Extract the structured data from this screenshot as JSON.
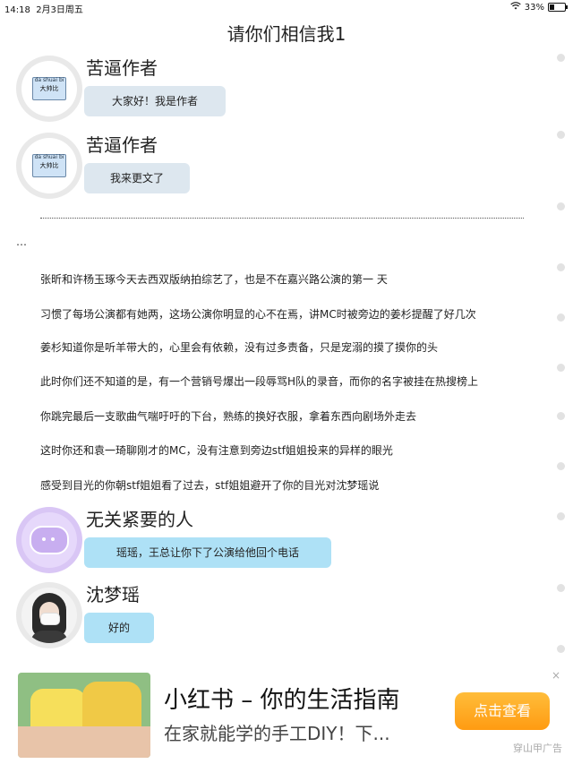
{
  "status_bar": {
    "time": "14:18",
    "date": "2月3日周五",
    "battery": "33%",
    "battery_level": 0.33
  },
  "page": {
    "title": "请你们相信我1"
  },
  "messages": [
    {
      "name": "苦逼作者",
      "text": "大家好！我是作者",
      "avatar_label_small": "da shuai bi",
      "avatar_label_big": "大帅比"
    },
    {
      "name": "苦逼作者",
      "text": "我来更文了",
      "avatar_label_small": "da shuai bi",
      "avatar_label_big": "大帅比"
    },
    {
      "name": "无关紧要的人",
      "text": "瑶瑶，王总让你下了公演给他回个电话"
    },
    {
      "name": "沈梦瑶",
      "text": "好的"
    }
  ],
  "narration": {
    "dots": "……………………………………………………………………………………………………………………………",
    "ellipsis": "…",
    "paragraphs": [
      "张昕和许杨玉琢今天去西双版纳拍综艺了，也是不在嘉兴路公演的第一 天",
      "习惯了每场公演都有她两，这场公演你明显的心不在焉，讲MC时被旁边的姜杉提醒了好几次",
      "姜杉知道你是听羊带大的，心里会有依赖，没有过多责备，只是宠溺的摸了摸你的头",
      "此时你们还不知道的是，有一个营销号爆出一段辱骂H队的录音，而你的名字被挂在热搜榜上",
      "你跳完最后一支歌曲气喘吁吁的下台，熟练的换好衣服，拿着东西向剧场外走去",
      "这时你还和袁一琦聊刚才的MC，没有注意到旁边stf姐姐投来的异样的眼光",
      "感受到目光的你朝stf姐姐看了过去，stf姐姐避开了你的目光对沈梦瑶说"
    ]
  },
  "ad": {
    "title": "小红书 – 你的生活指南",
    "subtitle": "在家就能学的手工DIY！下...",
    "button": "点击查看",
    "tag": "穿山甲广告",
    "close": "×"
  }
}
